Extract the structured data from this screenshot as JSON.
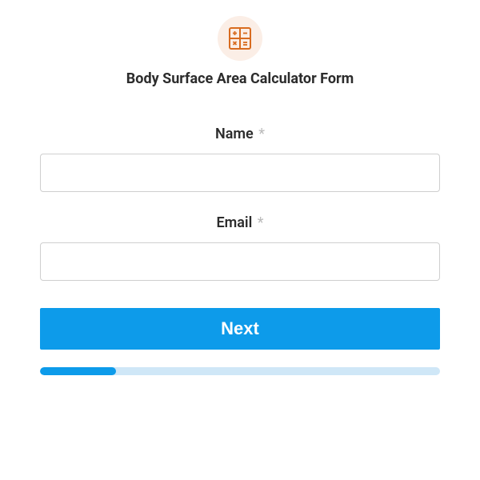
{
  "header": {
    "icon": "calculator-icon",
    "title": "Body Surface Area Calculator Form"
  },
  "fields": {
    "name": {
      "label": "Name",
      "required_marker": "*",
      "value": ""
    },
    "email": {
      "label": "Email",
      "required_marker": "*",
      "value": ""
    }
  },
  "actions": {
    "next_label": "Next"
  },
  "progress": {
    "percent": 19
  }
}
